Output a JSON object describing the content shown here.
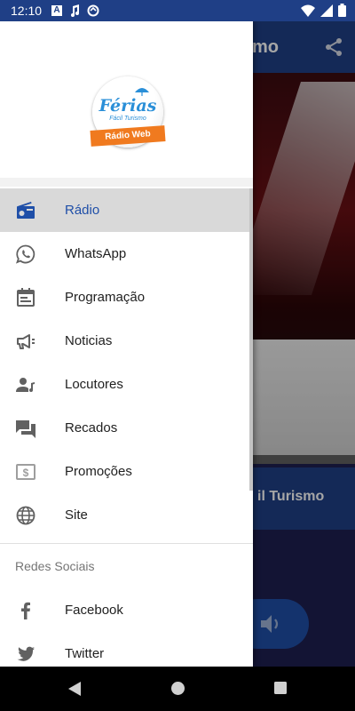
{
  "status_bar": {
    "time": "12:10",
    "notification_icons": [
      "a-square-icon",
      "music-note-icon",
      "sync-icon"
    ],
    "system_icons": [
      "wifi-icon",
      "signal-icon",
      "battery-icon"
    ]
  },
  "background_app": {
    "toolbar_title_visible": "mo",
    "station_name_visible": "il Turismo",
    "share_icon": "share-icon",
    "volume_icon": "volume-icon"
  },
  "drawer": {
    "logo": {
      "brand": "Férias",
      "tagline": "Fácil Turismo",
      "ribbon": "Rádio Web"
    },
    "items": [
      {
        "label": "Rádio",
        "icon": "radio-icon",
        "active": true
      },
      {
        "label": "WhatsApp",
        "icon": "whatsapp-icon",
        "active": false
      },
      {
        "label": "Programação",
        "icon": "calendar-icon",
        "active": false
      },
      {
        "label": "Noticias",
        "icon": "megaphone-icon",
        "active": false
      },
      {
        "label": "Locutores",
        "icon": "person-music-icon",
        "active": false
      },
      {
        "label": "Recados",
        "icon": "messages-icon",
        "active": false
      },
      {
        "label": "Promoções",
        "icon": "price-tag-icon",
        "active": false
      },
      {
        "label": "Site",
        "icon": "globe-icon",
        "active": false
      }
    ],
    "section_title": "Redes Sociais",
    "social": [
      {
        "label": "Facebook",
        "icon": "facebook-icon"
      },
      {
        "label": "Twitter",
        "icon": "twitter-icon"
      }
    ]
  },
  "colors": {
    "primary": "#1f3f86",
    "active_text": "#1f4fa8",
    "active_bg": "#d9d9d9",
    "logo_orange": "#f07a1f",
    "logo_blue": "#2a8fd8"
  },
  "nav_bar": [
    "back-icon",
    "home-icon",
    "recents-icon"
  ]
}
